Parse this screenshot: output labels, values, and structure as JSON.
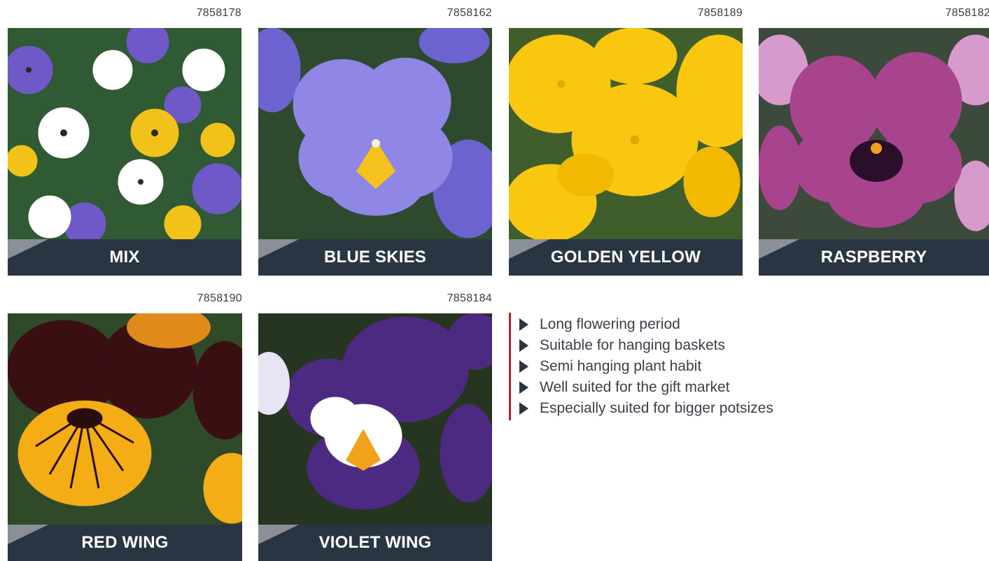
{
  "products": [
    {
      "code": "7858178",
      "name": "MIX",
      "colors": {
        "bg": "#2f5a33",
        "petal": "#ffffff",
        "center": "#f2c21a",
        "accent": "#6f58c8"
      }
    },
    {
      "code": "7858162",
      "name": "BLUE SKIES",
      "colors": {
        "bg": "#2e4a2e",
        "petal": "#8f86e6",
        "center": "#f4c21c",
        "accent": "#6d63cf"
      }
    },
    {
      "code": "7858189",
      "name": "GOLDEN YELLOW",
      "colors": {
        "bg": "#3f5e2c",
        "petal": "#f9c70f",
        "center": "#e3a600",
        "accent": "#f1b900"
      }
    },
    {
      "code": "7858182",
      "name": "RASPBERRY",
      "colors": {
        "bg": "#3c4a3c",
        "petal": "#a8448e",
        "center": "#f0a01a",
        "accent": "#d79acc"
      }
    },
    {
      "code": "7858190",
      "name": "RED WING",
      "colors": {
        "bg": "#2f4a28",
        "petal": "#f4ad14",
        "center": "#2a0d0a",
        "accent": "#3a0f12"
      }
    },
    {
      "code": "7858184",
      "name": "VIOLET WING",
      "colors": {
        "bg": "#26351f",
        "petal": "#ffffff",
        "center": "#f2a21a",
        "accent": "#4d2a82"
      }
    }
  ],
  "features": [
    "Long flowering period",
    "Suitable for hanging baskets",
    "Semi hanging plant habit",
    "Well suited for the gift market",
    "Especially suited for bigger potsizes"
  ],
  "icons": {
    "bullet": "triangle-right-icon"
  },
  "colors": {
    "label_bg": "#2a3544",
    "accent_rule": "#b3242c"
  }
}
